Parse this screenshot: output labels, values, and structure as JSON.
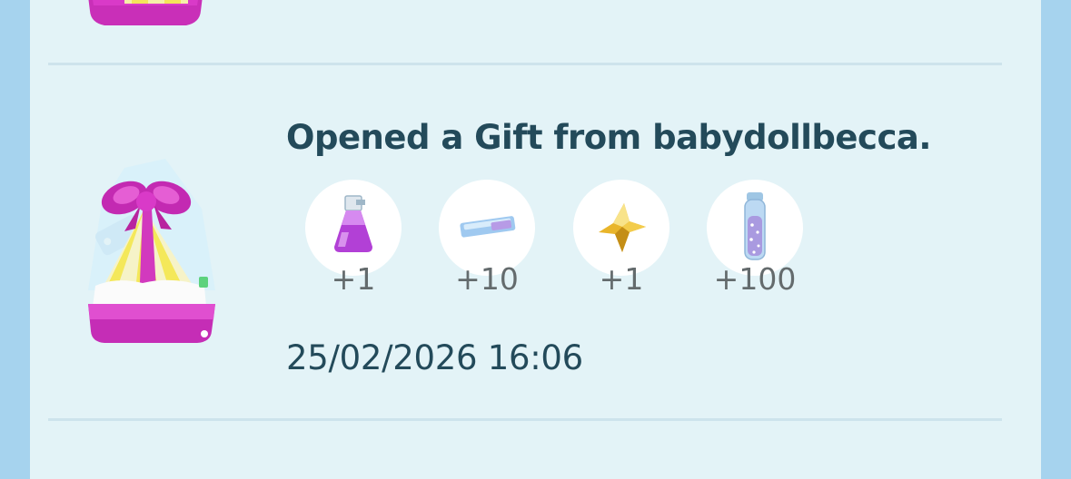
{
  "colors": {
    "background": "#a6d3ee",
    "panel": "#e3f3f7",
    "title_text": "#234a5a",
    "quantity_text": "#646b6d",
    "gift_box": "#d935c6",
    "gift_stripes": "#f4ee3c"
  },
  "entry": {
    "title": "Opened a Gift from babydollbecca.",
    "icon": "gift-icon",
    "rewards": [
      {
        "item": "potion-icon",
        "quantity": "+1"
      },
      {
        "item": "stardust-piece-icon",
        "quantity": "+10"
      },
      {
        "item": "stardust-star-icon",
        "quantity": "+1"
      },
      {
        "item": "stardust-vial-icon",
        "quantity": "+100"
      }
    ],
    "timestamp": "25/02/2026 16:06"
  }
}
